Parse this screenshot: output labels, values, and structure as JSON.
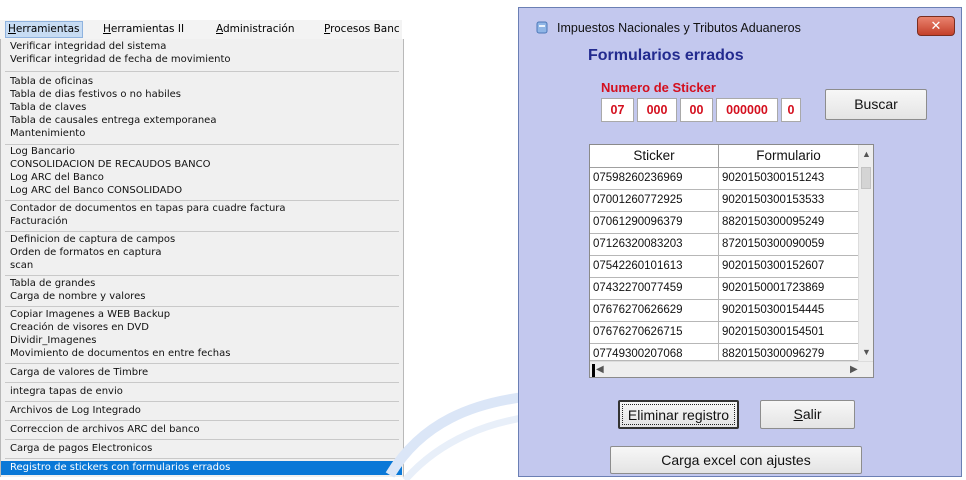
{
  "menubar": {
    "items": [
      {
        "label": "Herramientas",
        "active": true
      },
      {
        "label": "Herramientas II",
        "active": false
      },
      {
        "label": "Administración",
        "active": false
      },
      {
        "label": "Procesos Banc",
        "active": false
      }
    ]
  },
  "menu": {
    "items": [
      "Verificar integridad del sistema",
      "Verificar integridad de fecha de movimiento",
      "Tabla de oficinas",
      "Tabla de dias festivos o no habiles",
      "Tabla de claves",
      "Tabla de causales entrega  extemporanea",
      "Mantenimiento",
      "Log Bancario",
      "CONSOLIDACION DE RECAUDOS BANCO",
      "Log ARC del Banco",
      "Log ARC del Banco CONSOLIDADO",
      "Contador de documentos en tapas para cuadre factura",
      "Facturación",
      "Definicion de captura de campos",
      "Orden de formatos en captura",
      "scan",
      "Tabla de grandes",
      "Carga de nombre y valores",
      "Copiar Imagenes a WEB Backup",
      "Creación de visores en DVD",
      "Dividir_Imagenes",
      "Movimiento de documentos en entre fechas",
      "Carga de valores de Timbre",
      "integra tapas de envio",
      "Archivos de Log Integrado",
      "Correccion de archivos ARC del banco",
      "Carga de pagos Electronicos",
      "Registro de stickers con formularios errados"
    ],
    "selected_item": "Registro de stickers con formularios errados"
  },
  "dialog": {
    "window_title": "Impuestos Nacionales y Tributos Aduaneros",
    "close_glyph": "✕",
    "form_title": "Formularios errados",
    "sticker_label": "Numero de Sticker",
    "sticker_segments": [
      "07",
      "000",
      "00",
      "000000",
      "0"
    ],
    "buscar_label": "Buscar",
    "grid": {
      "columns": [
        "Sticker",
        "Formulario"
      ],
      "rows": [
        [
          "07598260236969",
          "9020150300151243"
        ],
        [
          "07001260772925",
          "9020150300153533"
        ],
        [
          "07061290096379",
          "8820150300095249"
        ],
        [
          "07126320083203",
          "8720150300090059"
        ],
        [
          "07542260101613",
          "9020150300152607"
        ],
        [
          "07432270077459",
          "9020150001723869"
        ],
        [
          "07676270626629",
          "9020150300154445"
        ],
        [
          "07676270626715",
          "9020150300154501"
        ],
        [
          "07749300207068",
          "8820150300096279"
        ]
      ]
    },
    "eliminar_label": "Eliminar registro",
    "salir_label": "Salir",
    "carga_label": "Carga excel con ajustes",
    "accent_color": "#232b8f",
    "label_color": "#d40f1e",
    "background_color": "#c3c8ee"
  }
}
